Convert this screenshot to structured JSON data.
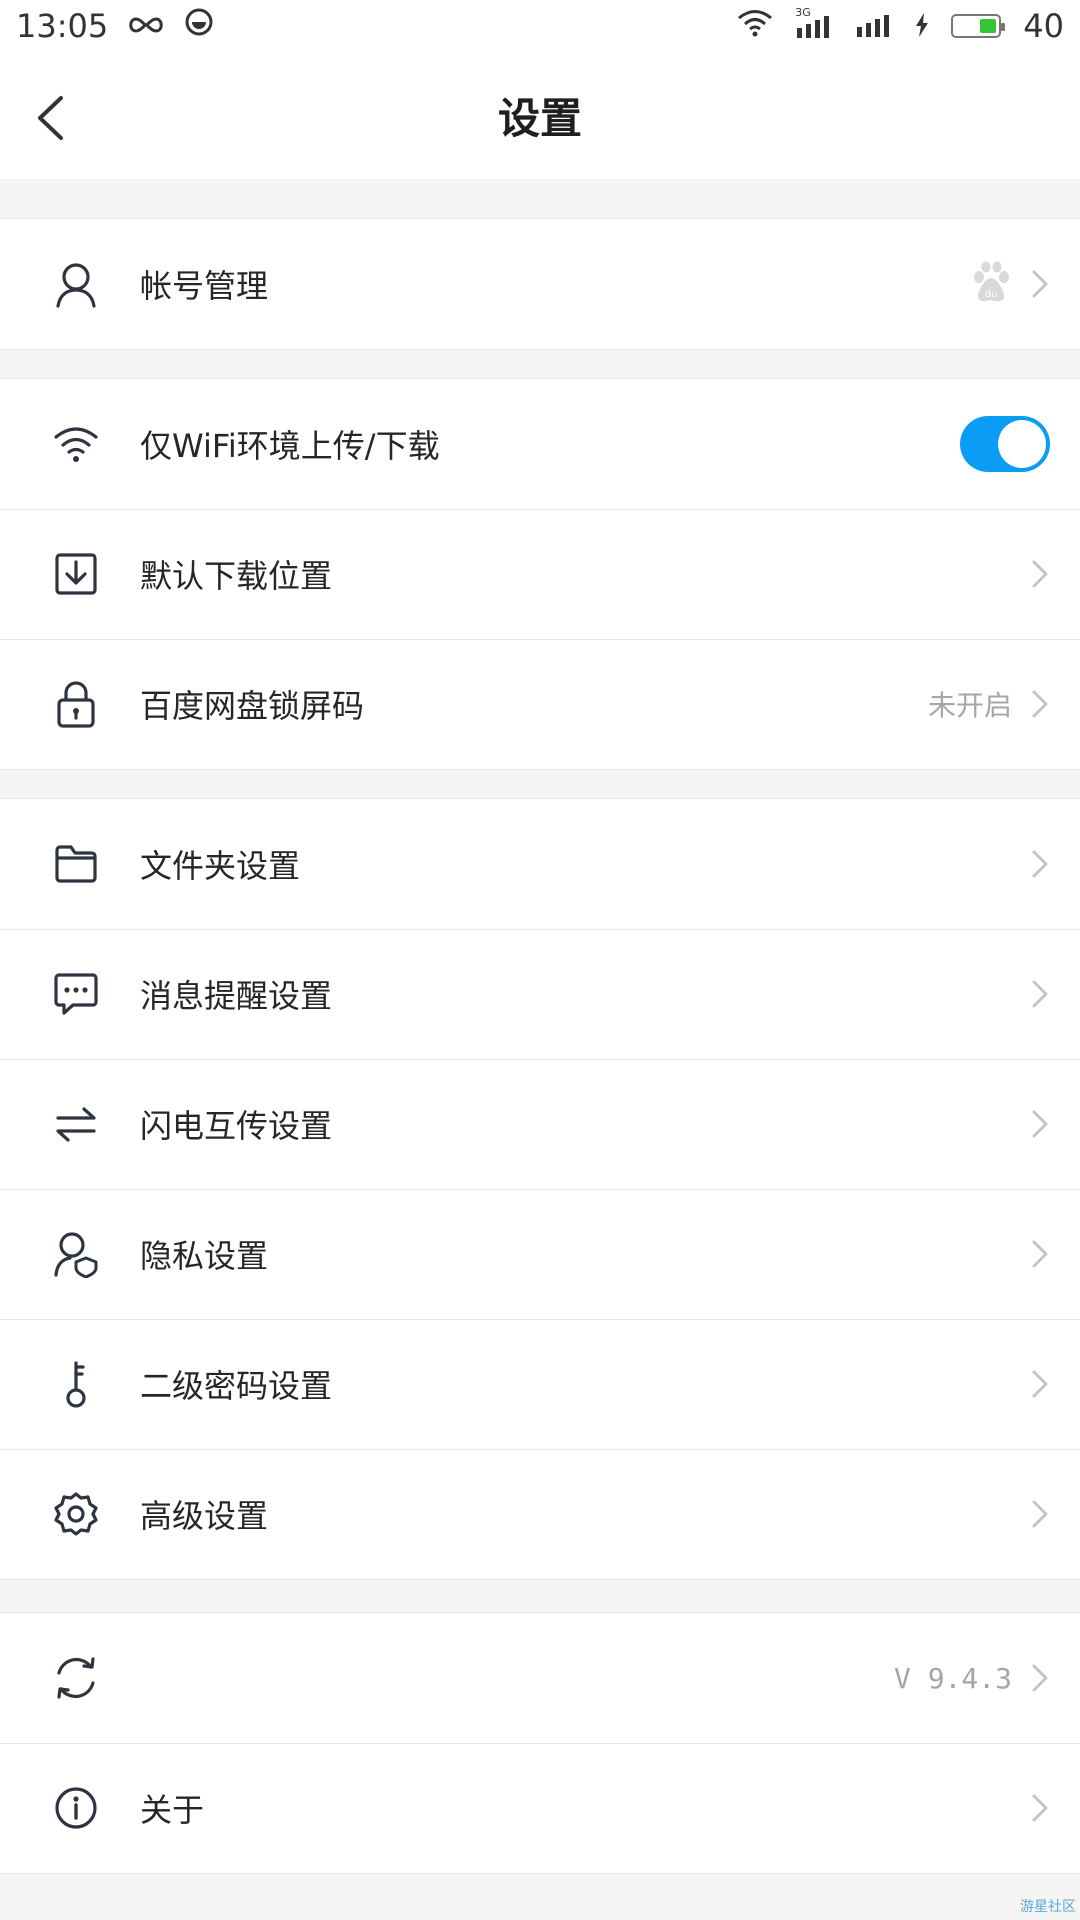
{
  "status_bar": {
    "time": "13:05",
    "network_label": "3G",
    "battery_level": "40"
  },
  "header": {
    "title": "设置"
  },
  "groups": {
    "account": {
      "label": "帐号管理",
      "badge_icon": "baidu-paw-icon"
    },
    "transfer": {
      "wifi_only": {
        "label": "仅WiFi环境上传/下载",
        "toggle_on": true
      },
      "download_location": {
        "label": "默认下载位置"
      },
      "lock_screen": {
        "label": "百度网盘锁屏码",
        "value": "未开启"
      }
    },
    "settings": {
      "folder": {
        "label": "文件夹设置"
      },
      "notify": {
        "label": "消息提醒设置"
      },
      "flash": {
        "label": "闪电互传设置"
      },
      "privacy": {
        "label": "隐私设置"
      },
      "password": {
        "label": "二级密码设置"
      },
      "advanced": {
        "label": "高级设置"
      }
    },
    "about": {
      "version": {
        "value": "V 9.4.3"
      },
      "about": {
        "label": "关于"
      }
    }
  },
  "watermark": "游星社区",
  "colors": {
    "accent": "#0b9df5",
    "battery": "#35c635",
    "icon": "#2e3440",
    "chevron": "#c4c4c4"
  }
}
